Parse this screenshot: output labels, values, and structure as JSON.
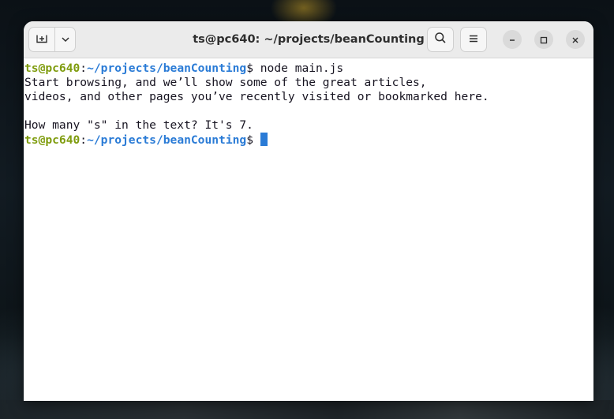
{
  "window": {
    "title": "ts@pc640: ~/projects/beanCounting"
  },
  "toolbar": {
    "new_tab_icon": "new-tab-icon",
    "dropdown_icon": "chevron-down-icon",
    "search_icon": "search-icon",
    "menu_icon": "hamburger-menu-icon",
    "minimize_icon": "minimize-icon",
    "maximize_icon": "maximize-icon",
    "close_icon": "close-icon"
  },
  "terminal": {
    "prompt": {
      "user_host": "ts@pc640",
      "colon": ":",
      "path": "~/projects/beanCounting",
      "dollar": "$ "
    },
    "command": "node main.js",
    "output": [
      "Start browsing, and we’ll show some of the great articles,",
      "videos, and other pages you’ve recently visited or bookmarked here.",
      "",
      "How many \"s\" in the text? It's 7."
    ]
  },
  "colors": {
    "prompt_user": "#7f9c0e",
    "prompt_path": "#2a7bd6",
    "cursor": "#2a7bd6",
    "titlebar": "#ebebeb"
  }
}
